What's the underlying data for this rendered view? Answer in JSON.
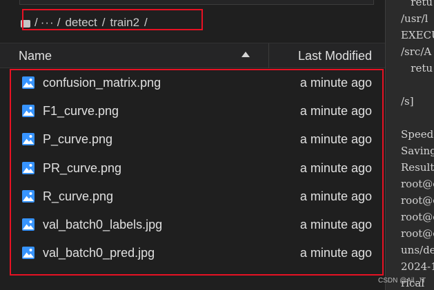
{
  "breadcrumb": {
    "root_sep": "/",
    "ellipsis": "···",
    "sep": "/",
    "part1": "detect",
    "part2": "train2",
    "trail": "/"
  },
  "table": {
    "col_name": "Name",
    "col_modified": "Last Modified",
    "rows": [
      {
        "name": "confusion_matrix.png",
        "modified": "a minute ago"
      },
      {
        "name": "F1_curve.png",
        "modified": "a minute ago"
      },
      {
        "name": "P_curve.png",
        "modified": "a minute ago"
      },
      {
        "name": "PR_curve.png",
        "modified": "a minute ago"
      },
      {
        "name": "R_curve.png",
        "modified": "a minute ago"
      },
      {
        "name": "val_batch0_labels.jpg",
        "modified": "a minute ago"
      },
      {
        "name": "val_batch0_pred.jpg",
        "modified": "a minute ago"
      }
    ]
  },
  "terminal": {
    "lines": [
      "   retu",
      "/usr/l",
      "EXECUT",
      "/src/A",
      "   retu",
      "",
      "/s]",
      "",
      "Speed",
      "Saving",
      "Result",
      "root@c",
      "root@c",
      "root@c",
      "root@c",
      "uns/de",
      "2024-1",
      "rical"
    ]
  },
  "watermark": "CSDN @Ail_JT",
  "colors": {
    "highlight": "#e81123",
    "icon": "#3794ff"
  }
}
